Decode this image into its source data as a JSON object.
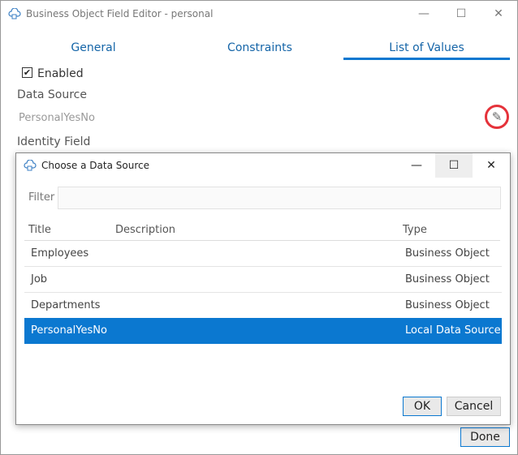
{
  "window": {
    "title": "Business Object Field Editor - personal",
    "icon": "cloud-icon"
  },
  "tabs": [
    {
      "label": "General"
    },
    {
      "label": "Constraints"
    },
    {
      "label": "List of Values",
      "active": true
    }
  ],
  "form": {
    "enabled_label": "Enabled",
    "enabled": true,
    "data_source_label": "Data Source",
    "data_source_value": "PersonalYesNo",
    "identity_field_label": "Identity Field"
  },
  "dialog": {
    "title": "Choose a Data Source",
    "filter_label": "Filter",
    "filter_value": "",
    "columns": [
      "Title",
      "Description",
      "Type"
    ],
    "rows": [
      {
        "title": "Employees",
        "description": "",
        "type": "Business Object"
      },
      {
        "title": "Job",
        "description": "",
        "type": "Business Object"
      },
      {
        "title": "Departments",
        "description": "",
        "type": "Business Object"
      },
      {
        "title": "PersonalYesNo",
        "description": "",
        "type": "Local Data Source",
        "selected": true
      }
    ],
    "ok_label": "OK",
    "cancel_label": "Cancel"
  },
  "done_label": "Done",
  "colors": {
    "accent": "#0b78d0",
    "highlight": "#e5323a"
  }
}
